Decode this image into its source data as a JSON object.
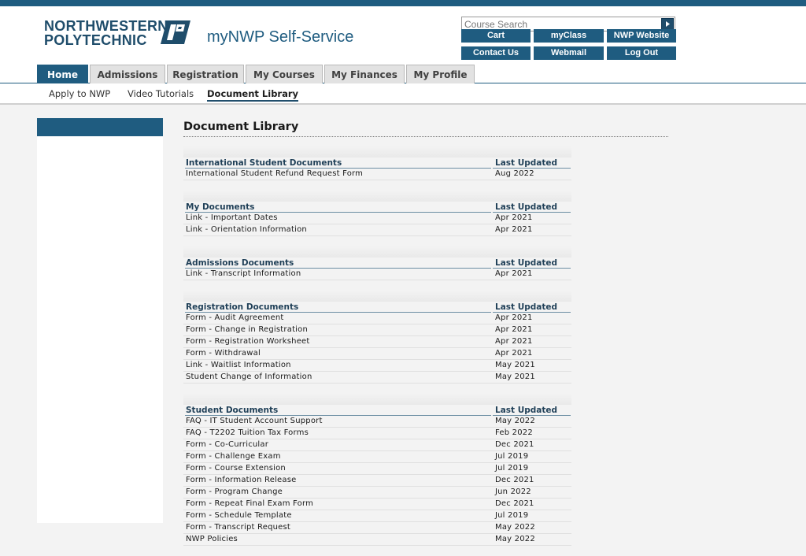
{
  "header": {
    "logo_line1": "NORTHWESTERN",
    "logo_line2": "POLYTECHNIC",
    "app_title": "myNWP Self-Service",
    "search_placeholder": "Course Search",
    "buttons": [
      "Cart",
      "myClass",
      "NWP Website",
      "Contact Us",
      "Webmail",
      "Log Out"
    ]
  },
  "tabs": [
    {
      "label": "Home",
      "active": true
    },
    {
      "label": "Admissions",
      "active": false
    },
    {
      "label": "Registration",
      "active": false
    },
    {
      "label": "My Courses",
      "active": false
    },
    {
      "label": "My Finances",
      "active": false
    },
    {
      "label": "My Profile",
      "active": false
    }
  ],
  "subnav": [
    {
      "label": "Apply to NWP",
      "active": false
    },
    {
      "label": "Video Tutorials",
      "active": false
    },
    {
      "label": "Document Library",
      "active": true
    }
  ],
  "page_title": "Document Library",
  "column_header_updated": "Last Updated",
  "sections": [
    {
      "name": "International Student Documents",
      "rows": [
        [
          "International Student Refund Request Form",
          "Aug 2022"
        ]
      ]
    },
    {
      "name": "My Documents",
      "rows": [
        [
          "Link - Important Dates",
          "Apr 2021"
        ],
        [
          "Link - Orientation Information",
          "Apr 2021"
        ]
      ]
    },
    {
      "name": "Admissions Documents",
      "rows": [
        [
          "Link - Transcript Information",
          "Apr 2021"
        ]
      ]
    },
    {
      "name": "Registration Documents",
      "rows": [
        [
          "Form - Audit Agreement",
          "Apr 2021"
        ],
        [
          "Form - Change in Registration",
          "Apr 2021"
        ],
        [
          "Form - Registration Worksheet",
          "Apr 2021"
        ],
        [
          "Form - Withdrawal",
          "Apr 2021"
        ],
        [
          "Link - Waitlist Information",
          "May 2021"
        ],
        [
          "Student Change of Information",
          "May 2021"
        ]
      ]
    },
    {
      "name": "Student Documents",
      "rows": [
        [
          "FAQ - IT Student Account Support",
          "May 2022"
        ],
        [
          "FAQ - T2202 Tuition Tax Forms",
          "Feb 2022"
        ],
        [
          "Form - Co-Curricular",
          "Dec 2021"
        ],
        [
          "Form - Challenge Exam",
          "Jul 2019"
        ],
        [
          "Form - Course Extension",
          "Jul 2019"
        ],
        [
          "Form - Information Release",
          "Dec 2021"
        ],
        [
          "Form - Program Change",
          "Jun 2022"
        ],
        [
          "Form - Repeat Final Exam Form",
          "Dec 2021"
        ],
        [
          "Form - Schedule Template",
          "Jul 2019"
        ],
        [
          "Form - Transcript Request",
          "May 2022"
        ],
        [
          "NWP Policies",
          "May 2022"
        ]
      ]
    }
  ],
  "colors": {
    "brand": "#1f5c80",
    "brand_dark": "#1f4d6b",
    "tab_inactive": "#e2e2e2",
    "background": "#f3f3f3"
  }
}
